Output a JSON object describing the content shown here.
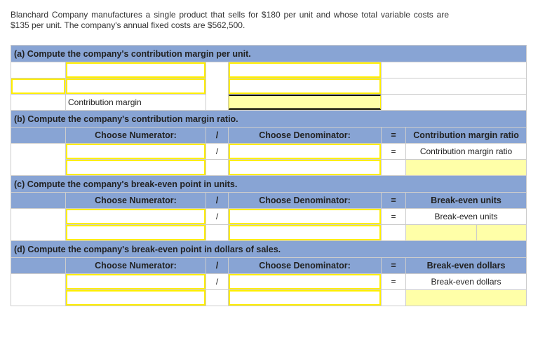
{
  "intro": "Blanchard Company manufactures a single product that sells for $180 per unit and whose total variable costs are $135 per unit. The company's annual fixed costs are $562,500.",
  "a": {
    "title": "(a)  Compute the company's contribution margin per unit.",
    "label": "Contribution margin"
  },
  "b": {
    "title": "(b) Compute the company's contribution margin ratio.",
    "numerator": "Choose Numerator:",
    "slash": "/",
    "denominator": "Choose Denominator:",
    "eq": "=",
    "result": "Contribution margin ratio"
  },
  "c": {
    "title": "(c)  Compute the company's break-even point in units.",
    "numerator": "Choose Numerator:",
    "slash": "/",
    "denominator": "Choose Denominator:",
    "eq": "=",
    "result": "Break-even units"
  },
  "d": {
    "title": "(d)  Compute the company's break-even point in dollars of sales.",
    "numerator": "Choose Numerator:",
    "slash": "/",
    "denominator": "Choose Denominator:",
    "eq": "=",
    "result": "Break-even dollars"
  }
}
